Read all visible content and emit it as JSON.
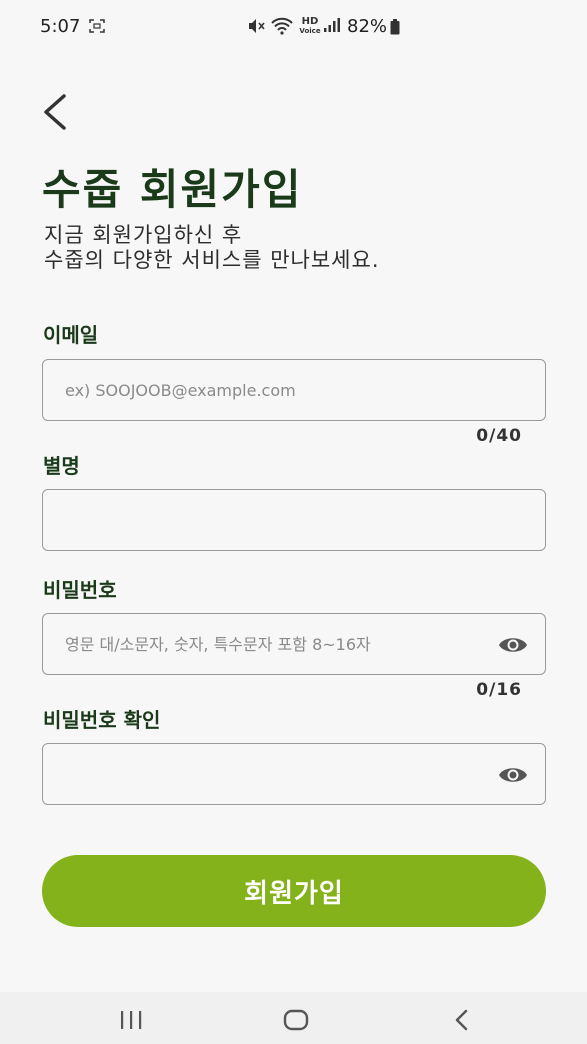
{
  "status_bar": {
    "time": "5:07",
    "hd_line1": "HD",
    "hd_line2": "Voice",
    "battery": "82%"
  },
  "header": {
    "title": "수줍 회원가입",
    "subtitle_line1": "지금 회원가입하신 후",
    "subtitle_line2": "수줍의 다양한 서비스를 만나보세요."
  },
  "form": {
    "email": {
      "label": "이메일",
      "placeholder": "ex) SOOJOOB@example.com",
      "value": "",
      "counter": "0/40"
    },
    "nickname": {
      "label": "별명",
      "placeholder": "",
      "value": ""
    },
    "password": {
      "label": "비밀번호",
      "placeholder": "영문 대/소문자, 숫자, 특수문자 포함 8~16자",
      "value": "",
      "counter": "0/16"
    },
    "password_confirm": {
      "label": "비밀번호 확인",
      "placeholder": "",
      "value": ""
    },
    "submit_label": "회원가입"
  },
  "icons": {
    "back": "back-arrow-icon",
    "eye": "eye-icon",
    "nav_recent": "recent-apps-icon",
    "nav_home": "home-icon",
    "nav_back": "nav-back-icon"
  },
  "colors": {
    "accent": "#83b21a",
    "title": "#1a3a1a",
    "background": "#f7f7f7"
  }
}
